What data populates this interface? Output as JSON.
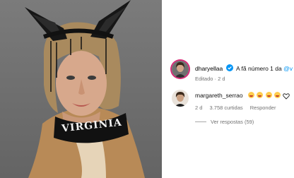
{
  "post": {
    "collar_text": "VIRGINIA"
  },
  "comments": [
    {
      "username": "dharyellaa",
      "text": "A fã número 1 da",
      "mention": "@v",
      "edited_label": "Editado",
      "time": "2 d"
    },
    {
      "username": "margareth_serrao",
      "text": "",
      "time": "2 d",
      "likes_label": "3.758 curtidas",
      "reply_label": "Responder",
      "view_replies_label": "Ver respostas (59)"
    }
  ],
  "colors": {
    "verified": "#0095f6",
    "muted": "#737373",
    "story_ring": "#d62976"
  }
}
